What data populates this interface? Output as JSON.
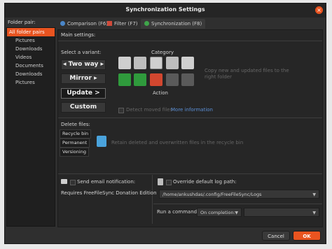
{
  "window": {
    "title": "Synchronization Settings",
    "close_glyph": "×"
  },
  "sidebar": {
    "label": "Folder pair:",
    "items": [
      "All folder pairs",
      "Pictures",
      "Downloads",
      "Videos",
      "Documents",
      "Downloads",
      "Pictures"
    ]
  },
  "tabs": [
    {
      "label": "Comparison (F6)",
      "icon": "gear-icon",
      "color": "#4a86c8"
    },
    {
      "label": "Filter (F7)",
      "icon": "funnel-icon",
      "color": "#d04a3a"
    },
    {
      "label": "Synchronization (F8)",
      "icon": "sync-icon",
      "color": "#3fa54a"
    }
  ],
  "main": {
    "main_settings": "Main settings:",
    "select_variant": "Select a variant:",
    "variants": [
      "◂ Two way ▸",
      "Mirror ▸",
      "Update >",
      "Custom"
    ],
    "selected_variant": "Update >",
    "category_label": "Category",
    "action_label": "Action",
    "hint_text_1": "Copy new and updated files to the",
    "hint_text_2": "right folder",
    "detect_moved": "Detect moved files",
    "more_info": "More information",
    "delete_files": "Delete files:",
    "delete_options": [
      "Recycle bin",
      "Permanent",
      "Versioning"
    ],
    "delete_hint": "Retain deleted and overwritten files in the recycle bin",
    "send_email": "Send email notification:",
    "requires": "Requires FreeFileSync Donation Edition",
    "override_log": "Override default log path:",
    "log_path": "/home/ankushdas/.config/FreeFileSync/Logs",
    "run_command": "Run a command:",
    "on_completion": "On completion:",
    "command_value": ""
  },
  "buttons": {
    "cancel": "Cancel",
    "ok": "OK"
  },
  "colors": {
    "accent": "#e95420",
    "ok": "#e95420"
  }
}
